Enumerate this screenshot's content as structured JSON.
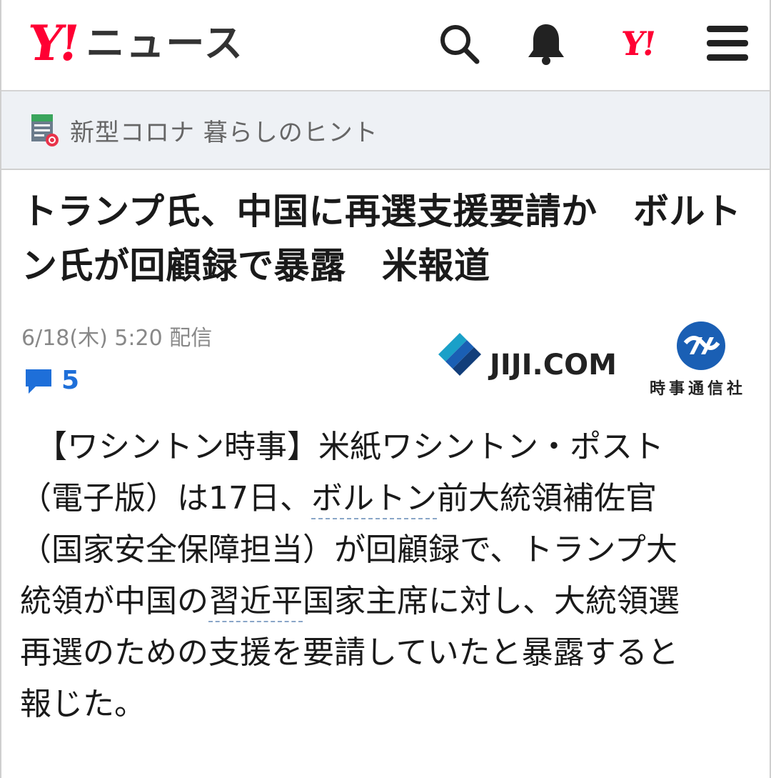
{
  "header": {
    "logo_mark": "Y!",
    "logo_text": "ニュース",
    "search_icon": "search-icon",
    "bell_icon": "bell-icon",
    "yahoo_icon_text": "Y!",
    "menu_icon": "hamburger-menu-icon"
  },
  "category": {
    "label": "新型コロナ 暮らしのヒント"
  },
  "article": {
    "title": "トランプ氏、中国に再選支援要請か　ボルトン氏が回顧録で暴露　米報道",
    "date": "6/18(木) 5:20 配信",
    "comment_count": "5",
    "source_logo_text": "JIJI.COM",
    "source_company": "時事通信社",
    "body_lines": [
      {
        "a": "　【ワシントン時事】米紙ワシントン・ポスト",
        "link": "",
        "b": ""
      },
      {
        "a": "（電子版）は17日、",
        "link": "ボルトン",
        "b": "前大統領補佐官"
      },
      {
        "a": "（国家安全保障担当）が回顧録で、トランプ大",
        "link": "",
        "b": ""
      },
      {
        "a": "統領が中国の",
        "link": "習近平",
        "b": "国家主席に対し、大統領選"
      },
      {
        "a": "再選のための支援を要請していたと暴露すると",
        "link": "",
        "b": ""
      },
      {
        "a": "報じた。",
        "link": "",
        "b": ""
      }
    ]
  },
  "colors": {
    "yahoo_red": "#ff0033",
    "comment_blue": "#1e6fd9",
    "jiji_blue": "#1a5fb4"
  }
}
